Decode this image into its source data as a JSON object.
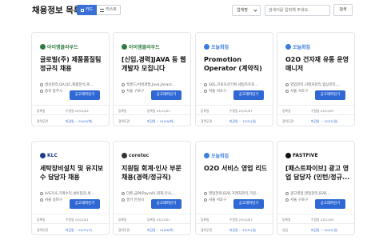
{
  "header": {
    "title": "채용정보 목록",
    "view_card": "카드",
    "view_list": "리스트",
    "filter_value": "업체명",
    "search_placeholder": "검색어를 입력해 주세요.",
    "search_button": "검색"
  },
  "colors": {
    "accent": "#2f68d4",
    "border": "#e3e6ec"
  },
  "cards": [
    {
      "logo": "아이엠클라우드",
      "logo_color": "#2f7a3f",
      "title": "글로벌(주) 제품품질팀 정규직 채용",
      "meta1": "생산관리,QA,QC,제품분석,로...",
      "meta2": "충북 충주시",
      "apply": "공고레퍼런기",
      "f1l": "등록일",
      "f1v": "수정일 23/12/02",
      "f2l": "경력무관",
      "f2v": "마감일 ~ 01/02(화)"
    },
    {
      "logo": "아이엠클라우드",
      "logo_color": "#2f7a3f",
      "title": "[신입,경력]JAVA 등 웹 개발자 모집니다",
      "meta1": "백엔드/서버개발,Java,Javasc...",
      "meta2": "서울 구로구",
      "apply": "공고레퍼런기",
      "f1l": "등록일",
      "f1v": "등록일 23/12/01",
      "f2l": "경력무관",
      "f2v": "마감일 ~ 01/30(화)"
    },
    {
      "logo": "오늘회집",
      "logo_color": "#3c7de0",
      "title": "Promotion Operator (계약직)",
      "meta1": "SQL,프로모션기획,세일즈프로...",
      "meta2": "서울 서초구",
      "apply": "공고레퍼런기",
      "f1l": "등록일",
      "f1v": "수정일 23/12/07",
      "f2l": "경력무관",
      "f2v": "마감일 ~ 12/31(일)"
    },
    {
      "logo": "오늘회집",
      "logo_color": "#3c7de0",
      "title": "O2O 건자재 유통 운영 매니저",
      "meta1": "영업관리,거래처관리,협상관리,...",
      "meta2": "서울 서초구",
      "apply": "공고레퍼런기",
      "f1l": "등록일",
      "f1v": "수정일 23/12/07",
      "f2l": "경력무관",
      "f2v": "마감일 ~ 12/31(일)"
    },
    {
      "logo": "KLC",
      "logo_color": "#1f3a8a",
      "title": "세탁장비설치 및 유지보수 담당자 채용",
      "meta1": "A/S기사,기계수리,설비점검,세...",
      "meta2": "서울 송파구",
      "apply": "공고레퍼런기",
      "f1l": "등록일",
      "f1v": "수정일 23/12/01",
      "f2l": "경력무관",
      "f2v": "마감일 ~ 01/31(수)"
    },
    {
      "logo": "coretec",
      "logo_color": "#333333",
      "title": "지원팀 회계·인사 부문 채용(경력/정규직)",
      "meta1": "더존,급여(Payroll),회계,인사,...",
      "meta2": "경기 안성시",
      "apply": "공고레퍼런기",
      "f1l": "등록일",
      "f1v": "등록일 23/12/01",
      "f2l": "경력무관",
      "f2v": "마감일 ~ 01/06(토)"
    },
    {
      "logo": "오늘회집",
      "logo_color": "#3c7de0",
      "title": "O2O 서비스 영업 리드",
      "meta1": "영업전략,B2B,거래처관리,기업...",
      "meta2": "서울 서초구",
      "apply": "공고레퍼런기",
      "f1l": "등록일",
      "f1v": "수정일 23/12/07",
      "f2l": "경력무관",
      "f2v": "마감일 ~ 12/31(일)"
    },
    {
      "logo": "FASTFIVE",
      "logo_color": "#111111",
      "title": "[패스트파이브] 광고 영업 담당자 (인턴/정규...",
      "meta1": "광고영업,영업관리,B2B,...",
      "meta2": "서울 구로구",
      "apply": "공고레퍼런기",
      "f1l": "등록일",
      "f1v": "수정일 23/12/01",
      "f2l": "신입",
      "f2v": "마감일 ~ 12/31(일)"
    }
  ]
}
